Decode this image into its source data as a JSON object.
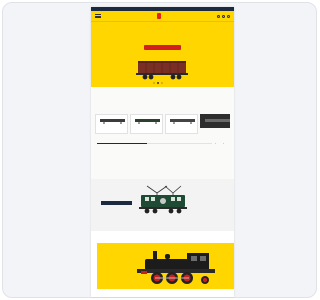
{
  "topbar": {
    "text": ""
  },
  "header": {
    "logo": ""
  },
  "nav": {
    "items": []
  },
  "hero": {
    "title": "",
    "button": ""
  },
  "new_products": {
    "title": "",
    "subtitle": "",
    "items": [
      {
        "name": "",
        "price": ""
      },
      {
        "name": "",
        "price": ""
      },
      {
        "name": "",
        "price": ""
      },
      {
        "name": "",
        "price": ""
      }
    ]
  },
  "promo": {
    "title": "",
    "button": ""
  },
  "bottom_banner": {
    "title": ""
  },
  "colors": {
    "brand_yellow": "#ffd600",
    "brand_red": "#d21e1e",
    "navy": "#1b2a41"
  }
}
